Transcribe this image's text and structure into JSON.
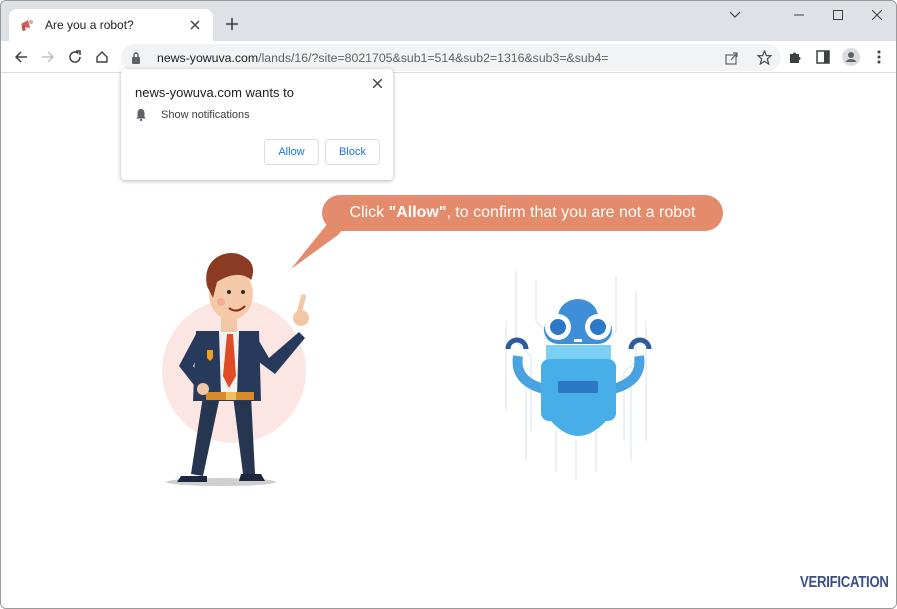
{
  "browser": {
    "tab": {
      "title": "Are you a robot?",
      "favicon": "megaphone-icon",
      "close_icon": "close-icon"
    },
    "new_tab_icon": "plus-icon",
    "window_controls": {
      "tab_search": "chevron-down-icon",
      "minimize": "minimize-icon",
      "maximize": "maximize-icon",
      "close": "close-icon"
    },
    "toolbar": {
      "back": "arrow-left-icon",
      "forward": "arrow-right-icon",
      "reload": "reload-icon",
      "home": "home-icon"
    },
    "address_bar": {
      "lock_icon": "lock-icon",
      "host": "news-yowuva.com",
      "path": "/lands/16/?site=8021705&sub1=514&sub2=1316&sub3=&sub4=",
      "share_icon": "share-icon",
      "bookmark_icon": "star-icon"
    },
    "right_icons": [
      "puzzle-icon",
      "side-panel-icon",
      "profile-icon",
      "kebab-menu-icon"
    ]
  },
  "permission_popup": {
    "title": "news-yowuva.com wants to",
    "permission_icon": "bell-icon",
    "permission_label": "Show notifications",
    "allow_label": "Allow",
    "block_label": "Block",
    "close_icon": "close-icon"
  },
  "page": {
    "bubble": {
      "prefix": "Click ",
      "bold": "\"Allow\"",
      "suffix": ", to confirm that you are not a robot",
      "color": "#e38b6b"
    },
    "illustrations": {
      "man": "businessman-pointing-illustration",
      "robot": "blue-robot-illustration"
    },
    "footer_logo": "VERIFICATION"
  }
}
